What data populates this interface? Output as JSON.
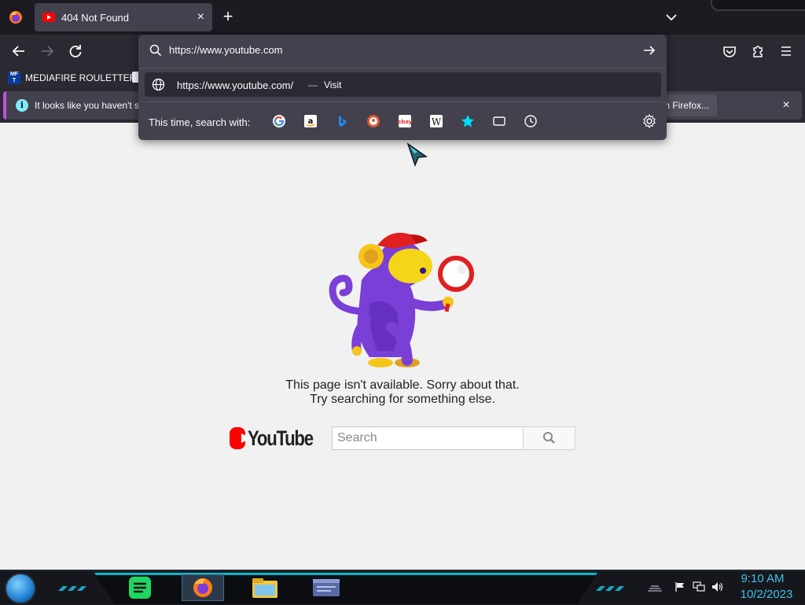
{
  "browser": {
    "tab": {
      "title": "404 Not Found",
      "close": "×"
    },
    "new_tab": "+",
    "bookmark": {
      "label": "MEDIAFIRE ROULETTER",
      "favicon_text": "MF T"
    },
    "notification": {
      "text": "It looks like you haven't s",
      "button": "h Firefox...",
      "close": "×",
      "info": "i"
    },
    "urlbar": {
      "value": "https://www.youtube.com",
      "suggestion_url": "https://www.youtube.com/",
      "suggestion_dash": "—",
      "suggestion_action": "Visit",
      "search_with_label": "This time, search with:",
      "engines": [
        "google-icon",
        "amazon-icon",
        "bing-icon",
        "duckduckgo-icon",
        "ebay-icon",
        "wikipedia-icon",
        "bookmarks-star-icon",
        "tabs-icon",
        "history-icon"
      ]
    }
  },
  "page": {
    "error_line1": "This page isn't available. Sorry about that.",
    "error_line2": "Try searching for something else.",
    "yt_wordmark": "YouTube",
    "search_placeholder": "Search"
  },
  "taskbar": {
    "time": "9:10 AM",
    "date": "10/2/2023",
    "accent": "#3fc3e8"
  },
  "colors": {
    "toolbar": "#2b2a33",
    "popup": "#42414d",
    "youtube_red": "#ff0000",
    "notification_accent": "#c050e0"
  }
}
